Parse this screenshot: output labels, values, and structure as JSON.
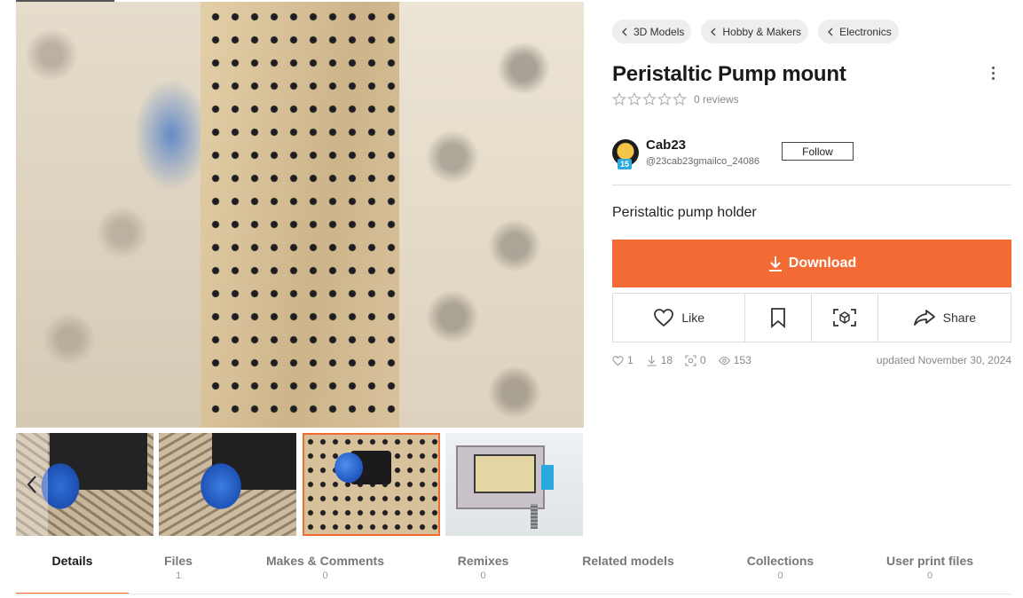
{
  "breadcrumbs": [
    {
      "label": "3D Models"
    },
    {
      "label": "Hobby & Makers"
    },
    {
      "label": "Electronics"
    }
  ],
  "model": {
    "title": "Peristaltic Pump mount",
    "rating_stars": 0,
    "reviews_label": "0 reviews",
    "summary": "Peristaltic pump holder",
    "updated": "updated November 30, 2024"
  },
  "author": {
    "name": "Cab23",
    "handle": "@23cab23gmailco_24086",
    "level_badge": "15",
    "follow_label": "Follow"
  },
  "download": {
    "label": "Download"
  },
  "actions": {
    "like_label": "Like",
    "share_label": "Share"
  },
  "stats": {
    "likes": "1",
    "downloads": "18",
    "ar_views": "0",
    "views": "153"
  },
  "tabs": [
    {
      "label": "Details",
      "count": ""
    },
    {
      "label": "Files",
      "count": "1"
    },
    {
      "label": "Makes & Comments",
      "count": "0"
    },
    {
      "label": "Remixes",
      "count": "0"
    },
    {
      "label": "Related models",
      "count": ""
    },
    {
      "label": "Collections",
      "count": "0"
    },
    {
      "label": "User print files",
      "count": "0"
    }
  ],
  "active_tab": "Details",
  "colors": {
    "accent": "#f26b35",
    "chip_bg": "#eeeeee",
    "muted_text": "#888888"
  },
  "icons": [
    "chevron-left-icon",
    "star-outline-icon",
    "kebab-menu-icon",
    "download-icon",
    "heart-icon",
    "bookmark-icon",
    "ar-view-icon",
    "share-icon",
    "eye-icon"
  ]
}
